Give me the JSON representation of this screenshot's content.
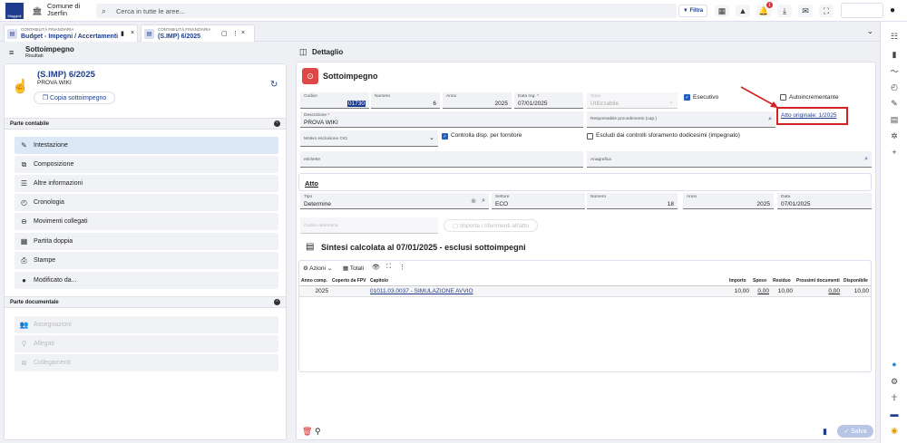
{
  "topbar": {
    "logo_text": "Maggioli",
    "municipality_prefix": "Comune di",
    "municipality_name": "Jserfin",
    "search_placeholder": "Cerca in tutte le aree...",
    "filter_label": "Filtra",
    "notification_count": "1"
  },
  "tabs": [
    {
      "supertitle": "CONTABILITÀ FINANZIARIA",
      "label": "Budget - Impegni / Accertamenti"
    },
    {
      "supertitle": "CONTABILITÀ FINANZIARIA",
      "label": "(S.IMP) 6/2025"
    }
  ],
  "left_header": {
    "title": "Sottoimpegno",
    "subtitle": "Risultati"
  },
  "right_header": {
    "title": "Dettaglio"
  },
  "record": {
    "title": "(S.IMP) 6/2025",
    "subtitle": "PROVA WIKI",
    "copy_label": "Copia sottoimpegno"
  },
  "sections": {
    "contabile": "Parte contabile",
    "documentale": "Parte documentale"
  },
  "nav": [
    {
      "label": "Intestazione",
      "icon": "pencil-icon"
    },
    {
      "label": "Composizione",
      "icon": "composition-icon"
    },
    {
      "label": "Altre informazioni",
      "icon": "list-icon"
    },
    {
      "label": "Cronologia",
      "icon": "history-icon"
    },
    {
      "label": "Movimenti collegati",
      "icon": "link-icon"
    },
    {
      "label": "Partita doppia",
      "icon": "grid-icon"
    },
    {
      "label": "Stampe",
      "icon": "print-icon"
    },
    {
      "label": "Modificato da...",
      "icon": "user-icon"
    }
  ],
  "nav_doc": [
    {
      "label": "Assegnazioni"
    },
    {
      "label": "Allegati"
    },
    {
      "label": "Collegamenti"
    }
  ],
  "form": {
    "title": "Sottoimpegno",
    "codice_label": "Codice",
    "codice_value": "01730",
    "numero_label": "Numero",
    "numero_value": "6",
    "anno_label": "Anno",
    "anno_value": "2025",
    "datareg_label": "Data reg.",
    "datareg_value": "07/01/2025",
    "stato_label": "Stato",
    "stato_value": "Utilizzabile",
    "esecutivo_label": "Esecutivo",
    "autoincr_label": "Autoincrementante",
    "descrizione_label": "Descrizione",
    "descrizione_value": "PROVA WIKI",
    "responsabile_label": "Responsabile procedimento (cap.)",
    "atto_originale": "Atto originale: 1/2025",
    "motivo_label": "Motivo esclusione CIG",
    "controlla_label": "Controlla disp. per fornitore",
    "escludi_label": "Escludi dai controlli sforamento dodicesimi (impegnato)",
    "etichette_label": "etichette",
    "anagrafica_label": "Anagrafica"
  },
  "atto": {
    "title": "Atto",
    "tipo_label": "Tipo",
    "tipo_value": "Determine",
    "settore_label": "Settore",
    "settore_value": "ECO",
    "numero_label": "Numero",
    "numero_value": "18",
    "anno_label": "Anno",
    "anno_value": "2025",
    "data_label": "Data",
    "data_value": "07/01/2025",
    "codice_det_label": "Codice determina",
    "importa_label": "Importa i riferimenti all'atto"
  },
  "sintesi": {
    "title": "Sintesi calcolata al 07/01/2025 - esclusi sottoimpegni",
    "azioni_label": "Azioni",
    "totali_label": "Totali",
    "columns": [
      "Anno comp.",
      "Coperto da FPV",
      "Capitolo",
      "Importo",
      "Speso",
      "Residuo",
      "Prossimi documenti",
      "Disponibile"
    ],
    "rows": [
      [
        "2025",
        "",
        "01011.03.0037 - SIMULAZIONE AVVIO",
        "10,00",
        "0,00",
        "10,00",
        "0,00",
        "10,00"
      ]
    ]
  },
  "footer": {
    "save_label": "Salva"
  },
  "colors": {
    "accent": "#1f3d8a",
    "highlight": "#d22222"
  }
}
